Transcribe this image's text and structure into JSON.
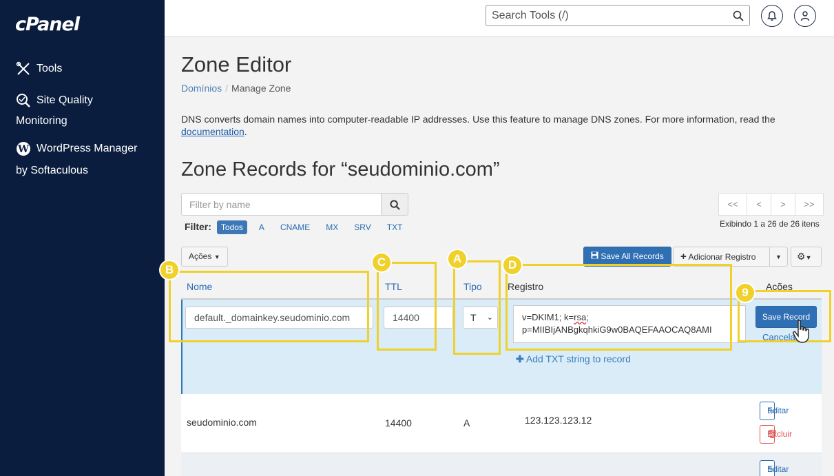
{
  "sidebar": {
    "logo": "cPanel",
    "items": [
      {
        "label": "Tools",
        "icon": "tools-icon"
      },
      {
        "label": "Site Quality",
        "label2": "Monitoring",
        "icon": "magnifier-icon"
      },
      {
        "label": "WordPress Manager",
        "label2": "by Softaculous",
        "icon": "wordpress-icon"
      }
    ]
  },
  "topbar": {
    "search_placeholder": "Search Tools (/)",
    "icons": [
      "search-icon",
      "bell-icon",
      "user-icon"
    ]
  },
  "page": {
    "title": "Zone Editor",
    "breadcrumb": {
      "parent": "Domínios",
      "sep": "/",
      "current": "Manage Zone"
    },
    "description": "DNS converts domain names into computer-readable IP addresses. Use this feature to manage DNS zones. For more information, read the",
    "description_link": "documentation",
    "description_end": ".",
    "zone_title": "Zone Records for “seudominio.com”"
  },
  "filter": {
    "placeholder": "Filter by name",
    "label": "Filter:",
    "chips": [
      "Todos",
      "A",
      "CNAME",
      "MX",
      "SRV",
      "TXT"
    ],
    "active": "Todos"
  },
  "pagination": {
    "buttons": [
      "<<",
      "<",
      ">",
      ">>"
    ],
    "info": "Exibindo 1 a 26 de 26 itens"
  },
  "toolbar": {
    "actions": "Ações",
    "save_all": "Save All Records",
    "add_record": "Adicionar Registro"
  },
  "table": {
    "headers": {
      "name": "Nome",
      "ttl": "TTL",
      "type": "Tipo",
      "record": "Registro",
      "actions": "Ações"
    },
    "edit_row": {
      "name": "default._domainkey.seudominio.com",
      "ttl": "14400",
      "type": "T",
      "record_line1": "v=DKIM1; k=",
      "record_sq": "rsa",
      "record_line1_end": ";",
      "record_line2": "p=MIIBIjANBgkqhkiG9w0BAQEFAAOCAQ8AMI",
      "add_txt": "Add TXT string to record",
      "save": "Save Record",
      "cancel": "Cancelar"
    },
    "rows": [
      {
        "name": "seudominio.com",
        "ttl": "14400",
        "type": "A",
        "record": "123.123.123.12",
        "edit": "Editar",
        "delete": "Excluir"
      },
      {
        "edit": "Editar"
      }
    ]
  },
  "annotations": {
    "badges": [
      "A",
      "B",
      "C",
      "D",
      "9"
    ],
    "color": "#f0d12b"
  },
  "colors": {
    "sidebar": "#0b1d3e",
    "primary": "#2f6fb3",
    "edit_row_bg": "#d9ecf7",
    "danger": "#d9534f"
  }
}
